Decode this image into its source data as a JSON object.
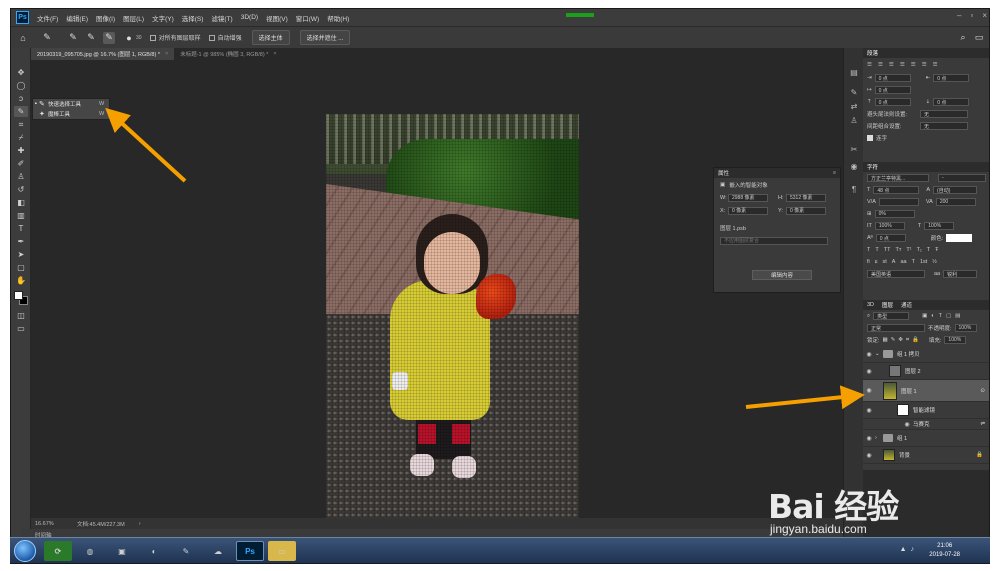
{
  "app": {
    "logo": "Ps",
    "menu": [
      "文件(F)",
      "编辑(E)",
      "图像(I)",
      "图层(L)",
      "文字(Y)",
      "选择(S)",
      "滤镜(T)",
      "3D(D)",
      "视图(V)",
      "窗口(W)",
      "帮助(H)"
    ],
    "window_buttons": [
      "–",
      "▫",
      "×"
    ]
  },
  "options_bar": {
    "brush_size": "30",
    "sample_all_layers": "对所有图层取样",
    "auto_enhance": "自动增强",
    "select_subject": "选择主体",
    "select_and_mask": "选择并遮住 ..."
  },
  "tabs": [
    {
      "label": "20190319_095705.jpg @ 16.7% (图层 1, RGB/8) *",
      "active": true
    },
    {
      "label": "未标题-1 @ 985% (椭圆 3, RGB/8) *",
      "active": false
    }
  ],
  "flyout": {
    "items": [
      {
        "label": "快速选择工具",
        "key": "W",
        "selected": true
      },
      {
        "label": "魔棒工具",
        "key": "W",
        "selected": false
      }
    ]
  },
  "status": {
    "zoom": "16.67%",
    "doc": "文档:45.4M/227.3M",
    "timeline": "时间轴"
  },
  "properties": {
    "tab": "属性",
    "type": "嵌入的智能对象",
    "w_label": "W:",
    "w_value": "2988 像素",
    "h_label": "H:",
    "h_value": "5312 像素",
    "x_label": "X:",
    "x_value": "0 像素",
    "y_label": "Y:",
    "y_value": "0 像素",
    "file": "图层 1.psb",
    "comp_placeholder": "不应用图层复合",
    "edit_button": "编辑内容"
  },
  "paragraph": {
    "tab": "段落",
    "val_0pt": "0 点",
    "hyphen_label": "避头尾法则设置:",
    "hyphen_value": "无",
    "spacing_label": "间距组合设置:",
    "spacing_value": "无",
    "hyphenate": "连字"
  },
  "character": {
    "tab": "字符",
    "font": "方正兰亭特黑...",
    "font_style": "-",
    "size": "48 点",
    "leading": "(自动)",
    "tracking": "200",
    "scale_pct": "0%",
    "v_scale": "100%",
    "h_scale": "100%",
    "baseline": "0 点",
    "color_label": "颜色:",
    "language": "美国英语",
    "aa": "锐利"
  },
  "layers": {
    "tabs": [
      "3D",
      "图层",
      "通道"
    ],
    "kind": "类型",
    "blend": "正常",
    "opacity_label": "不透明度:",
    "opacity": "100%",
    "lock_label": "锁定:",
    "fill_label": "填充:",
    "fill": "100%",
    "items": [
      {
        "name": "组 1 拷贝",
        "type": "group"
      },
      {
        "name": "图层 2",
        "type": "layer"
      },
      {
        "name": "图层 1",
        "type": "smart",
        "selected": true
      },
      {
        "name": "智能滤镜",
        "type": "filter"
      },
      {
        "name": "马赛克",
        "type": "subfilter"
      },
      {
        "name": "组 1",
        "type": "group"
      },
      {
        "name": "背景",
        "type": "bg"
      }
    ]
  },
  "taskbar": {
    "time": "21:06",
    "date": "2019-07-28",
    "ps": "Ps"
  },
  "watermark": {
    "brand": "Bai 经验",
    "url": "jingyan.baidu.com"
  },
  "accents": {
    "arrow": "#f5a000",
    "ps_blue": "#31a8ff"
  }
}
